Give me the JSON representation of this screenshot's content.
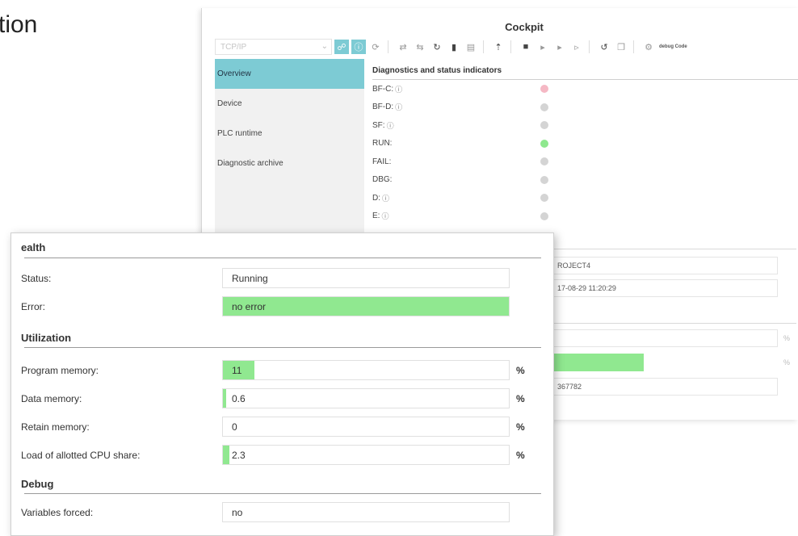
{
  "page": {
    "heading": "tion"
  },
  "cockpit": {
    "title": "Cockpit",
    "connection": "TCP/IP",
    "nav": [
      {
        "label": "Overview",
        "active": true
      },
      {
        "label": "Device",
        "active": false
      },
      {
        "label": "PLC runtime",
        "active": false
      },
      {
        "label": "Diagnostic archive",
        "active": false
      }
    ],
    "diagnostics_title": "Diagnostics and status indicators",
    "info_glyph": "ⓘ",
    "leds": [
      {
        "label": "BF-C:",
        "info": true,
        "color": "#f5b8c4"
      },
      {
        "label": "BF-D:",
        "info": true,
        "color": "#d4d4d4"
      },
      {
        "label": "SF:",
        "info": true,
        "color": "#d4d4d4"
      },
      {
        "label": "RUN:",
        "info": false,
        "color": "#8ee88e"
      },
      {
        "label": "FAIL:",
        "info": false,
        "color": "#d4d4d4"
      },
      {
        "label": "DBG:",
        "info": false,
        "color": "#d4d4d4"
      },
      {
        "label": "D:",
        "info": true,
        "color": "#d4d4d4"
      },
      {
        "label": "E:",
        "info": true,
        "color": "#d4d4d4"
      }
    ],
    "project_name": "ROJECT4",
    "timestamp": "17-08-29 11:20:29",
    "right_value": "367782",
    "pct": "%",
    "toolbar_debug": "debug Code"
  },
  "health": {
    "title": "Health",
    "title_visible": "ealth",
    "status_label": "Status:",
    "status_label_visible": "Status:",
    "status_value": "Running",
    "error_label": "Error:",
    "error_label_visible": "Error:",
    "error_value": "no error"
  },
  "utilization": {
    "title": "Utilization",
    "unit": "%",
    "rows": [
      {
        "label": "Program memory:",
        "value": "11",
        "percent": 11
      },
      {
        "label": "Data memory:",
        "value": "0.6",
        "percent": 0.6
      },
      {
        "label": "Retain memory:",
        "value": "0",
        "percent": 0
      },
      {
        "label": "Load of allotted CPU share:",
        "value": "2.3",
        "percent": 2.3
      }
    ]
  },
  "debug": {
    "title": "Debug",
    "variables_forced_label": "Variables forced:",
    "variables_forced_value": "no"
  },
  "colors": {
    "accent": "#7dcbd4",
    "ok_green": "#90e890",
    "error_pink": "#f5b8c4"
  }
}
